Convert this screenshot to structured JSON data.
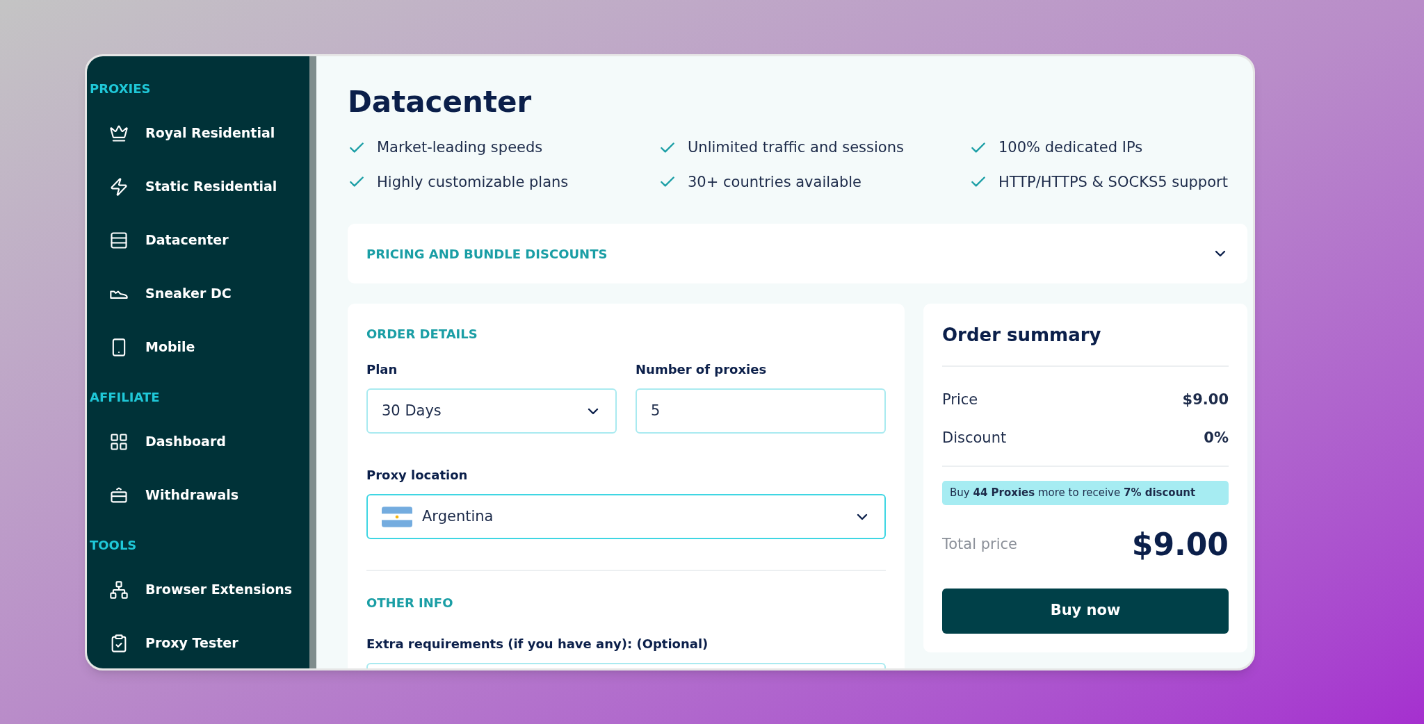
{
  "sidebar": {
    "sections": [
      {
        "title": "PROXIES",
        "items": [
          {
            "label": "Royal Residential"
          },
          {
            "label": "Static Residential"
          },
          {
            "label": "Datacenter"
          },
          {
            "label": "Sneaker DC"
          },
          {
            "label": "Mobile"
          }
        ]
      },
      {
        "title": "AFFILIATE",
        "items": [
          {
            "label": "Dashboard"
          },
          {
            "label": "Withdrawals"
          }
        ]
      },
      {
        "title": "TOOLS",
        "items": [
          {
            "label": "Browser Extensions"
          },
          {
            "label": "Proxy Tester"
          }
        ]
      }
    ]
  },
  "page": {
    "title": "Datacenter",
    "features": [
      "Market-leading speeds",
      "Unlimited traffic and sessions",
      "100% dedicated IPs",
      "Highly customizable plans",
      "30+ countries available",
      "HTTP/HTTPS & SOCKS5 support"
    ]
  },
  "pricing": {
    "title": "PRICING AND BUNDLE DISCOUNTS",
    "expanded": false
  },
  "order": {
    "section_title": "ORDER DETAILS",
    "plan": {
      "label": "Plan",
      "value": "30 Days"
    },
    "count": {
      "label": "Number of proxies",
      "value": "5"
    },
    "location": {
      "label": "Proxy location",
      "value": "Argentina"
    },
    "other_title": "OTHER INFO",
    "extra": {
      "label": "Extra requirements (if you have any): (Optional)"
    }
  },
  "summary": {
    "title": "Order summary",
    "rows": [
      {
        "label": "Price",
        "value": "$9.00"
      },
      {
        "label": "Discount",
        "value": "0%"
      }
    ],
    "notice": "Buy **44 Proxies** more to receive **7% discount**",
    "total_label": "Total price",
    "total_value": "$9.00",
    "button": "Buy now"
  }
}
